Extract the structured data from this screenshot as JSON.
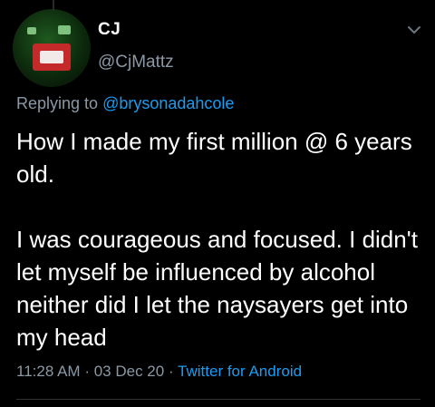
{
  "user": {
    "display_name": "CJ",
    "handle": "@CjMattz"
  },
  "reply": {
    "prefix": "Replying to",
    "mention": "@brysonadahcole"
  },
  "tweet": {
    "text": "How I made my first million @ 6 years old.\n\nI was courageous and focused. I didn't let myself be influenced by alcohol neither did I let the naysayers get into my head"
  },
  "meta": {
    "time": "11:28 AM",
    "date": "03 Dec 20",
    "source": "Twitter for Android",
    "separator": "·"
  },
  "icons": {
    "menu": "chevron-down-icon"
  },
  "colors": {
    "background": "#000000",
    "text": "#ffffff",
    "muted": "#8b98a5",
    "link": "#1d9bf0"
  }
}
